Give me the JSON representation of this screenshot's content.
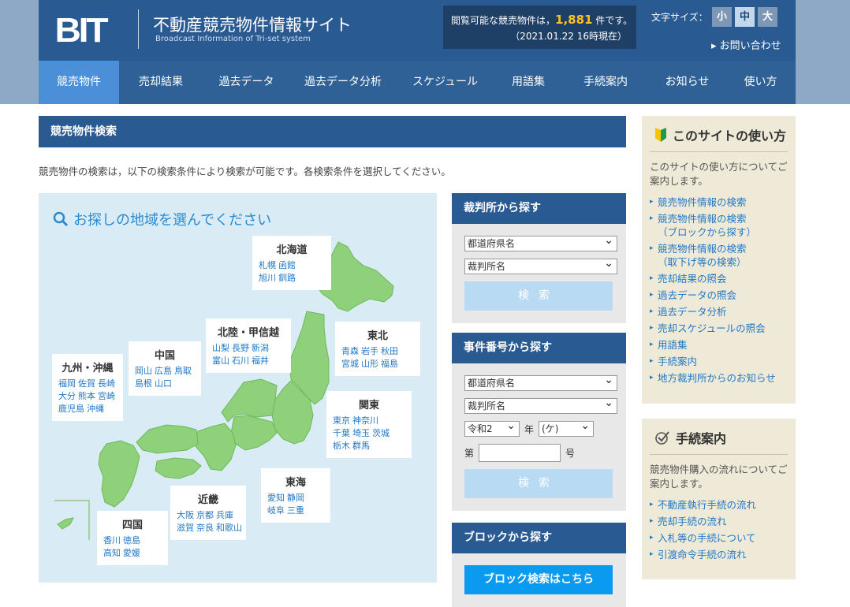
{
  "header": {
    "logo": "BIT",
    "site_title": "不動産競売物件情報サイト",
    "site_subtitle": "Broadcast Information of Tri-set system",
    "count_prefix": "閲覧可能な競売物件は，",
    "count_value": "1,881",
    "count_suffix": " 件です。",
    "count_time": "（2021.01.22 16時現在）",
    "font_size_label": "文字サイズ：",
    "font_sizes": [
      "小",
      "中",
      "大"
    ],
    "contact": "▸ お問い合わせ"
  },
  "nav": [
    "競売物件",
    "売却結果",
    "過去データ",
    "過去データ分析",
    "スケジュール",
    "用語集",
    "手続案内",
    "お知らせ",
    "使い方"
  ],
  "main": {
    "title": "競売物件検索",
    "intro": "競売物件の検索は，以下の検索条件により検索が可能です。各検索条件を選択してください。",
    "map_heading": "お探しの地域を選んでください",
    "regions": {
      "hokkaido": {
        "name": "北海道",
        "rows": [
          [
            "札幌",
            "函館"
          ],
          [
            "旭川",
            "釧路"
          ]
        ]
      },
      "tohoku": {
        "name": "東北",
        "rows": [
          [
            "青森",
            "岩手",
            "秋田"
          ],
          [
            "宮城",
            "山形",
            "福島"
          ]
        ]
      },
      "hokuriku": {
        "name": "北陸・甲信越",
        "rows": [
          [
            "山梨",
            "長野",
            "新潟"
          ],
          [
            "富山",
            "石川",
            "福井"
          ]
        ]
      },
      "kanto": {
        "name": "関東",
        "rows": [
          [
            "東京",
            "神奈川"
          ],
          [
            "千葉",
            "埼玉",
            "茨城"
          ],
          [
            "栃木",
            "群馬"
          ]
        ]
      },
      "chugoku": {
        "name": "中国",
        "rows": [
          [
            "岡山",
            "広島",
            "鳥取"
          ],
          [
            "島根",
            "山口"
          ]
        ]
      },
      "kyushu": {
        "name": "九州・沖縄",
        "rows": [
          [
            "福岡",
            "佐賀",
            "長崎"
          ],
          [
            "大分",
            "熊本",
            "宮崎"
          ],
          [
            "鹿児島",
            "沖縄"
          ]
        ]
      },
      "tokai": {
        "name": "東海",
        "rows": [
          [
            "愛知",
            "静岡"
          ],
          [
            "岐阜",
            "三重"
          ]
        ]
      },
      "kinki": {
        "name": "近畿",
        "rows": [
          [
            "大阪",
            "京都",
            "兵庫"
          ],
          [
            "滋賀",
            "奈良",
            "和歌山"
          ]
        ]
      },
      "shikoku": {
        "name": "四国",
        "rows": [
          [
            "香川",
            "徳島"
          ],
          [
            "高知",
            "愛媛"
          ]
        ]
      }
    }
  },
  "search": {
    "court": {
      "title": "裁判所から探す",
      "prefecture": "都道府県名",
      "court": "裁判所名",
      "button": "検索"
    },
    "case": {
      "title": "事件番号から探す",
      "prefecture": "都道府県名",
      "court": "裁判所名",
      "era": "令和2",
      "year_label": "年",
      "type": "(ケ)",
      "no_prefix": "第",
      "no_suffix": "号",
      "button": "検索"
    },
    "block": {
      "title": "ブロックから探す",
      "button": "ブロック検索はこちら"
    }
  },
  "sidebar": {
    "usage": {
      "title": "このサイトの使い方",
      "desc": "このサイトの使い方についてご案内します。",
      "links": [
        "競売物件情報の検索",
        "競売物件情報の検索\n（ブロックから探す）",
        "競売物件情報の検索\n（取下げ等の検索）",
        "売却結果の照会",
        "過去データの照会",
        "過去データ分析",
        "売却スケジュールの照会",
        "用語集",
        "手続案内",
        "地方裁判所からのお知らせ"
      ]
    },
    "procedure": {
      "title": "手続案内",
      "desc": "競売物件購入の流れについてご案内します。",
      "links": [
        "不動産執行手続の流れ",
        "売却手続の流れ",
        "入札等の手続について",
        "引渡命令手続の流れ"
      ]
    }
  },
  "colors": {
    "brand": "#2a5a92",
    "accent": "#4a8fd8",
    "count": "#ffc21e",
    "land": "#8fd07a",
    "sea": "#d9ecf6"
  }
}
